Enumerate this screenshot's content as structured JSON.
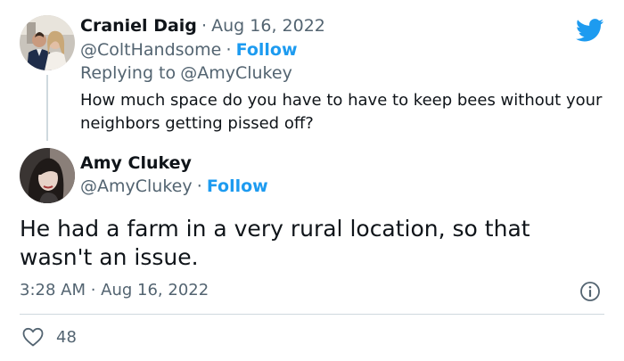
{
  "reply_tweet": {
    "author_name": "Craniel Daig",
    "separator": "·",
    "date": "Aug 16, 2022",
    "handle": "@ColtHandsome",
    "follow_label": "Follow",
    "replying_prefix": "Replying to",
    "replying_handle": "@AmyClukey",
    "text": "How much space do you have to have to keep bees without your neighbors getting pissed off?"
  },
  "main_tweet": {
    "author_name": "Amy Clukey",
    "handle": "@AmyClukey",
    "separator": "·",
    "follow_label": "Follow",
    "text": "He had a farm in a very rural location, so that wasn't an issue.",
    "timestamp": "3:28 AM · Aug 16, 2022",
    "likes_count": "48"
  },
  "icons": {
    "brand": "twitter-bird-icon",
    "info": "info-icon",
    "like": "heart-icon"
  },
  "colors": {
    "brand_blue": "#1d9bf0",
    "muted": "#536471",
    "text": "#0f1419",
    "divider": "#cfd9de"
  }
}
